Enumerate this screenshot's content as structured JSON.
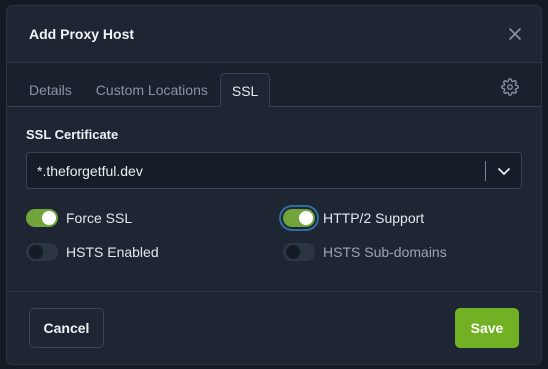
{
  "modal": {
    "title": "Add Proxy Host"
  },
  "tabs": [
    {
      "label": "Details"
    },
    {
      "label": "Custom Locations"
    },
    {
      "label": "SSL",
      "active": true
    }
  ],
  "ssl": {
    "certificate_label": "SSL Certificate",
    "certificate_value": "*.theforgetful.dev",
    "toggles": [
      {
        "label": "Force SSL",
        "on": true
      },
      {
        "label": "HTTP/2 Support",
        "on": true
      },
      {
        "label": "HSTS Enabled",
        "on": false
      },
      {
        "label": "HSTS Sub-domains",
        "on": false
      }
    ]
  },
  "footer": {
    "cancel_label": "Cancel",
    "save_label": "Save"
  },
  "colors": {
    "accent_green": "#72b124",
    "toggle_on": "#71a53c",
    "background": "#1e2634"
  },
  "icons": [
    "close-icon",
    "gear-icon",
    "chevron-down-icon"
  ]
}
